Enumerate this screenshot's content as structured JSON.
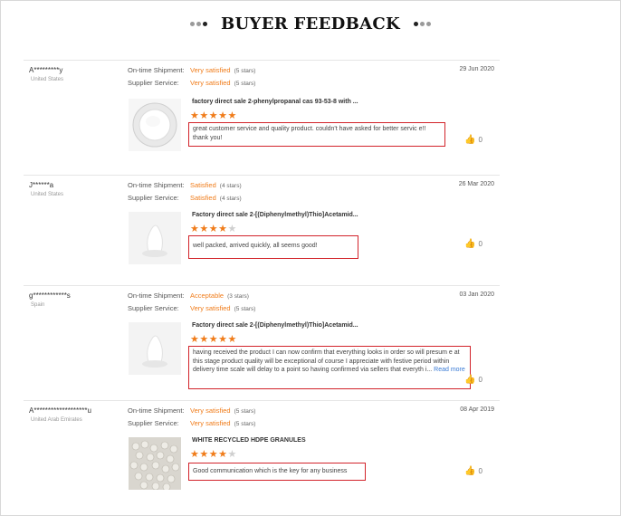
{
  "header": {
    "title": "BUYER FEEDBACK"
  },
  "labels": {
    "shipment": "On-time Shipment:",
    "service": "Supplier Service:"
  },
  "reviews": [
    {
      "name": "A*********y",
      "country": "United States",
      "date": "29 Jun 2020",
      "shipment": "Very satisfied",
      "shipment_stars": "(5 stars)",
      "service": "Very satisfied",
      "service_stars": "(5 stars)",
      "product": "factory direct sale 2-phenylpropanal cas 93-53-8 with ...",
      "rating": 5,
      "feedback": "great customer service and quality product. couldn't have asked for better servic e!!  thank you!",
      "likes": "0"
    },
    {
      "name": "J******a",
      "country": "United States",
      "date": "26 Mar 2020",
      "shipment": "Satisfied",
      "shipment_stars": "(4 stars)",
      "service": "Satisfied",
      "service_stars": "(4 stars)",
      "product": "Factory direct sale 2-[(Diphenylmethyl)Thio]Acetamid...",
      "rating": 4,
      "feedback": "well packed, arrived quickly, all seems good!",
      "likes": "0"
    },
    {
      "name": "g************s",
      "country": "Spain",
      "date": "03 Jan 2020",
      "shipment": "Acceptable",
      "shipment_stars": "(3 stars)",
      "service": "Very satisfied",
      "service_stars": "(5 stars)",
      "product": "Factory direct sale 2-[(Diphenylmethyl)Thio]Acetamid...",
      "rating": 5,
      "feedback": "having received the product I can now confirm that everything looks in order so will presum e at this stage product quality will be exceptional of course I appreciate with festive period within delivery time scale will delay to a point so having confirmed via sellers that everyth i...",
      "read_more": "Read more",
      "likes": "0"
    },
    {
      "name": "A*******************u",
      "country": "United Arab Emirates",
      "date": "08 Apr 2019",
      "shipment": "Very satisfied",
      "shipment_stars": "(5 stars)",
      "service": "Very satisfied",
      "service_stars": "(5 stars)",
      "product": "WHITE RECYCLED HDPE GRANULES",
      "rating": 4,
      "feedback": "Good communication which is the key for any business",
      "likes": "0"
    }
  ]
}
